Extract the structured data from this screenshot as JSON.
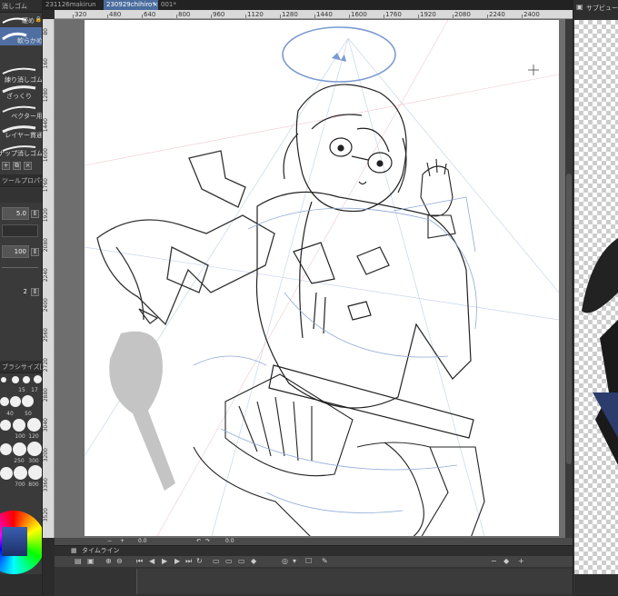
{
  "tabs": [
    {
      "label": "231126makirun"
    },
    {
      "label": "230929chihiro*"
    },
    {
      "label": "001*"
    }
  ],
  "tab_close": "×",
  "ruler_labels": [
    "320",
    "480",
    "640",
    "800",
    "960",
    "1120",
    "1280",
    "1440",
    "1600",
    "1760",
    "1920",
    "2080",
    "2240",
    "2400"
  ],
  "vruler_labels": [
    "6",
    "1120",
    "1440",
    "1600",
    "1920",
    "2080",
    "2240",
    "2560",
    "2720",
    "2880",
    "3040",
    "3200",
    "3360",
    "3520"
  ],
  "vruler_top": [
    "80",
    "160",
    "1280",
    "1440",
    "1600",
    "1760",
    "1920",
    "2080",
    "2240",
    "2400",
    "2560",
    "2720",
    "2880",
    "3040",
    "3200",
    "3360",
    "3520"
  ],
  "left_panel": {
    "header": "消しゴム",
    "brushes": [
      {
        "label": "硬め"
      },
      {
        "label": "軟らかめ"
      },
      {
        "label": "練り消しゴム"
      },
      {
        "label": "ざっくり"
      },
      {
        "label": "ベクター用"
      },
      {
        "label": "レイヤー貫通"
      },
      {
        "label": "スナップ消しゴム"
      }
    ],
    "tool_property_header": "ツールプロパティ[軟らかめ]",
    "size_value": "5.0",
    "opacity_value": "100",
    "hardness_value": "2",
    "brush_size_header": "ブラシサイズ[軟らかめ]",
    "size_labels": [
      "15",
      "17",
      "40",
      "50",
      "100",
      "120",
      "250",
      "300",
      "700",
      "800"
    ]
  },
  "status": {
    "zoom": "0.0",
    "angle": "0.0"
  },
  "timeline": {
    "label": "タイムライン"
  },
  "right_panel": {
    "header": "サブビュー"
  }
}
